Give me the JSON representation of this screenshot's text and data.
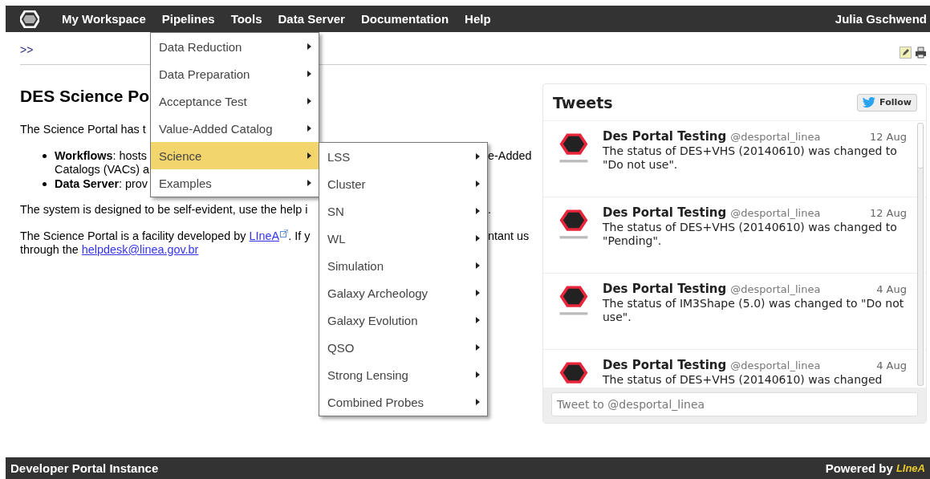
{
  "nav": {
    "items": [
      {
        "label": "My Workspace"
      },
      {
        "label": "Pipelines"
      },
      {
        "label": "Tools"
      },
      {
        "label": "Data Server"
      },
      {
        "label": "Documentation"
      },
      {
        "label": "Help"
      }
    ],
    "user": "Julia Gschwend"
  },
  "breadcrumb": ">>",
  "content": {
    "heading": "DES Science Po",
    "lines": [
      {
        "kind": "para",
        "left": "The Science Portal has t"
      },
      {
        "kind": "bullet",
        "left": "**Workflows**: hosts",
        "right": "e-Added"
      },
      {
        "kind": "cont",
        "left": "Catalogs (VACs) a"
      },
      {
        "kind": "bullet",
        "left": "**Data Server**: prov"
      },
      {
        "kind": "gap",
        "left": "The system is designed to be self-evident, use the help i",
        "right": "."
      },
      {
        "kind": "gap",
        "left": "The Science Portal is a facility developed by ",
        "link": "LIneA",
        "after": ". If y",
        "right": "ntant us"
      },
      {
        "kind": "cont2",
        "left": "through the ",
        "link": "helpdesk@linea.gov.br"
      }
    ]
  },
  "menu": {
    "items": [
      {
        "label": "Data Reduction",
        "selected": false
      },
      {
        "label": "Data Preparation",
        "selected": false
      },
      {
        "label": "Acceptance Test",
        "selected": false
      },
      {
        "label": "Value-Added Catalog",
        "selected": false
      },
      {
        "label": "Science",
        "selected": true
      },
      {
        "label": "Examples",
        "selected": false
      }
    ]
  },
  "submenu": {
    "items": [
      {
        "label": "LSS",
        "selected": false
      },
      {
        "label": "Cluster",
        "selected": false
      },
      {
        "label": "SN",
        "selected": false
      },
      {
        "label": "WL",
        "selected": false
      },
      {
        "label": "Simulation",
        "selected": false
      },
      {
        "label": "Galaxy Archeology",
        "selected": false
      },
      {
        "label": "Galaxy Evolution",
        "selected": false
      },
      {
        "label": "QSO",
        "selected": false
      },
      {
        "label": "Strong Lensing",
        "selected": false
      },
      {
        "label": "Combined Probes",
        "selected": false
      }
    ]
  },
  "tweets_widget": {
    "title": "Tweets",
    "follow": "Follow",
    "tweets": [
      {
        "name": "Des Portal Testing",
        "handle": "@desportal_linea",
        "date": "12 Aug",
        "text": "The status of DES+VHS (20140610) was changed to \"Do not use\"."
      },
      {
        "name": "Des Portal Testing",
        "handle": "@desportal_linea",
        "date": "12 Aug",
        "text": "The status of DES+VHS (20140610) was changed to \"Pending\"."
      },
      {
        "name": "Des Portal Testing",
        "handle": "@desportal_linea",
        "date": "4 Aug",
        "text": "The status of IM3Shape (5.0) was changed to \"Do not use\"."
      },
      {
        "name": "Des Portal Testing",
        "handle": "@desportal_linea",
        "date": "4 Aug",
        "text": "The status of DES+VHS (20140610) was changed"
      }
    ],
    "placeholder": "Tweet to @desportal_linea"
  },
  "footer": {
    "left": "Developer Portal Instance",
    "powered": "Powered by",
    "logo": "LIneA"
  }
}
